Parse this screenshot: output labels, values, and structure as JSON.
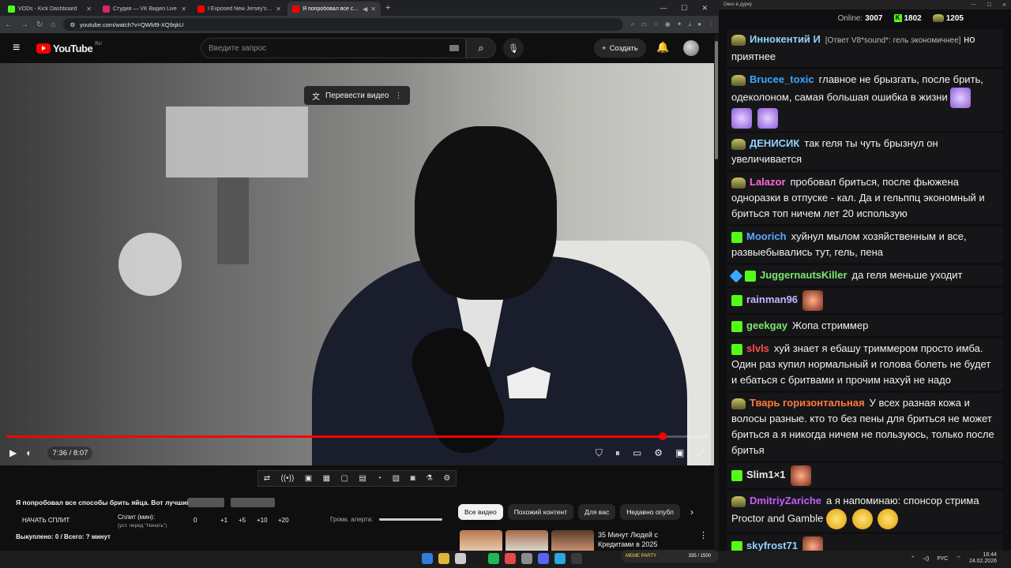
{
  "browser": {
    "tabs": [
      {
        "label": "VODs - Kick Dashboard",
        "color": "#53fc18",
        "active": false
      },
      {
        "label": "Студия — VK Видео Live",
        "color": "#e0245e",
        "active": false
      },
      {
        "label": "I Exposed New Jersey's Jewish",
        "color": "#ff0000",
        "active": false
      },
      {
        "label": "Я попробовал все способы",
        "color": "#ff0000",
        "active": true
      }
    ],
    "url": "youtube.com/watch?v=QWM9-XQ9qkU"
  },
  "youtube": {
    "logo": "YouTube",
    "region": "RU",
    "search_placeholder": "Введите запрос",
    "create_label": "Создать",
    "translate_label": "Перевести видео",
    "time": "7:36 / 8:07",
    "progress": 0.936,
    "video_title": "Я попробовал все способы брить яйца. Вот лучший",
    "chips": [
      "Все видео",
      "Похожий контент",
      "Для вас",
      "Недавно опубл"
    ],
    "rec_title": "35 Минут Людей с Кредитами в 2025"
  },
  "overlay": {
    "split_label": "НАЧАТЬ СПЛИТ",
    "split_min": "Сплит (мин):",
    "split_hint": "(уст. перед \"Начать\")",
    "values": [
      "0",
      "+1",
      "+5",
      "+10",
      "+20"
    ],
    "alert_volume": "Громк. алерта:",
    "bought": "Выкуплено: 0 / Всего: ? минут"
  },
  "chat": {
    "window_title": "Окно в дурку",
    "online_label": "Online:",
    "online": "3007",
    "kick_count": "1802",
    "other_count": "1205",
    "messages": [
      {
        "user": "Иннокентий И",
        "color": "#8fd3ff",
        "reply": "[Ответ V8*sound*: гель экономичнее]",
        "text": "но приятнее",
        "icon": "emote"
      },
      {
        "user": "Brucee_toxic",
        "color": "#3ba7ff",
        "text": "главное не брызгать, после брить, одеколоном, самая большая ошибка в жизни",
        "icon": "emote",
        "emotes": 3
      },
      {
        "user": "ДЕНИСИК",
        "color": "#8fd3ff",
        "text": "так геля ты чуть брызнул он увеличивается",
        "icon": "emote"
      },
      {
        "user": "Lalazor",
        "color": "#ff6ad5",
        "text": "пробовал бриться, после фьюжена одноразки в отпуске - кал. Да и гельппц экономный и бриться топ ничем лет 20 использую",
        "icon": "emote"
      },
      {
        "user": "Moorich",
        "color": "#59a7ff",
        "text": "хуйнул мылом хозяйственным и все, развыебывались тут, гель, пена",
        "icon": "k"
      },
      {
        "user": "JuggernautsKiller",
        "color": "#7be86f",
        "text": "да геля меньше уходит",
        "icon": "k",
        "sword": true
      },
      {
        "user": "rainman96",
        "color": "#c9b3ff",
        "text": "",
        "icon": "k",
        "face": true
      },
      {
        "user": "geekgay",
        "color": "#7be86f",
        "text": "Жопа стриммер",
        "icon": "k"
      },
      {
        "user": "slvls",
        "color": "#ff4b4b",
        "text": "хуй знает я ебашу триммером просто имба. Один раз купил нормальный и голова болеть не будет и ебаться с бритвами и прочим нахуй не надо",
        "icon": "k"
      },
      {
        "user": "Тварь горизонтальная",
        "color": "#ff7a3d",
        "text": "У всех разная кожа и волосы разные. кто то без пены для бриться не может бриться а я никогда ничем не пользуюсь, только после бритья",
        "icon": "emote"
      },
      {
        "user": "Slim1×1",
        "color": "#e8e8e8",
        "text": "",
        "icon": "k",
        "face": true
      },
      {
        "user": "DmitriyZariche",
        "color": "#c45cff",
        "text": "а я напоминаю: спонсор стрима Proctor and Gamble",
        "icon": "emote",
        "laugh": 3
      },
      {
        "user": "skyfrost71",
        "color": "#8fd3ff",
        "text": "",
        "icon": "k",
        "face": true
      }
    ]
  },
  "taskbar": {
    "game_label": "MEME PARTY",
    "game_count": "335 / 1500",
    "lang": "РУС",
    "time": "16:44",
    "date": "24.02.2026"
  }
}
